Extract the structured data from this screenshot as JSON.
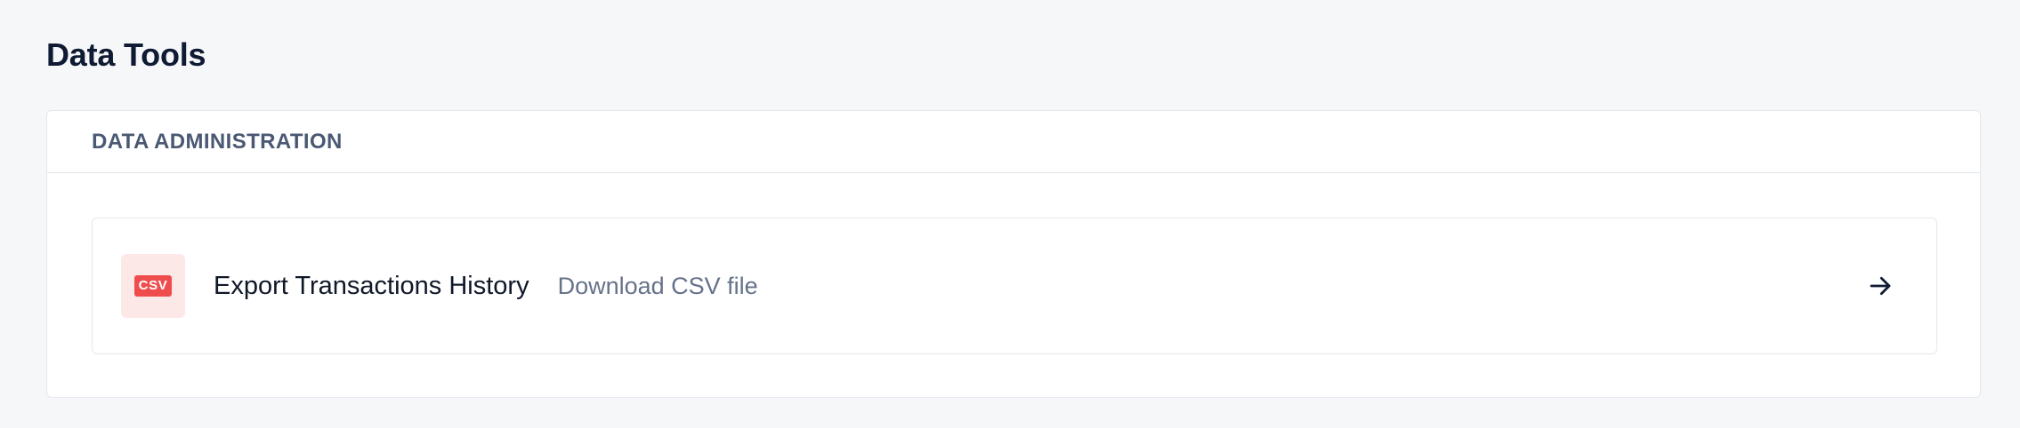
{
  "page": {
    "title": "Data Tools"
  },
  "section": {
    "title": "DATA ADMINISTRATION"
  },
  "items": [
    {
      "icon": "csv-file-icon",
      "badge_text": "CSV",
      "title": "Export Transactions History",
      "subtitle": "Download CSV file",
      "action_icon": "arrow-right-icon"
    }
  ],
  "colors": {
    "background": "#f6f7f9",
    "badge_background": "#fde8e8",
    "badge_accent": "#ef4d4d",
    "title_text": "#0f1b33"
  }
}
